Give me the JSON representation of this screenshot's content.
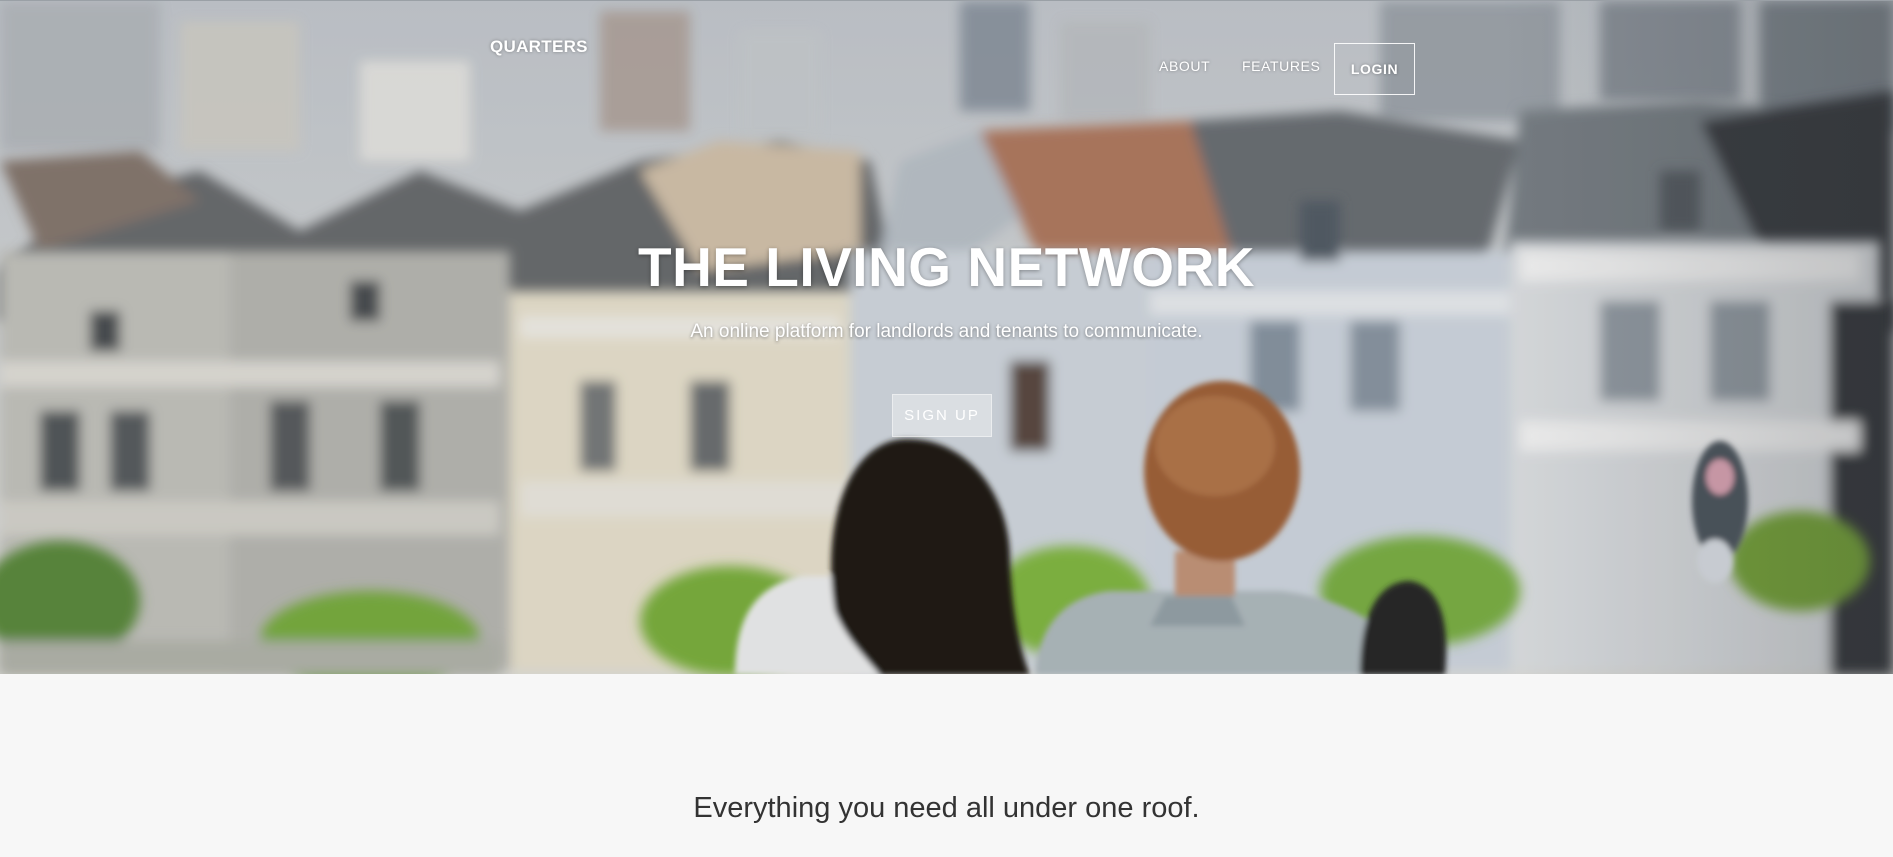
{
  "nav": {
    "brand": "QUARTERS",
    "links": [
      "ABOUT",
      "FEATURES"
    ],
    "login": "LOGIN"
  },
  "hero": {
    "title": "THE LIVING NETWORK",
    "subtitle": "An online platform for landlords and tenants to communicate.",
    "cta": "SIGN UP",
    "image": "blurred-victorian-houses-with-couple-photo"
  },
  "section": {
    "heading": "Everything you need all under one roof."
  },
  "colors": {
    "hero_text": "#ffffff",
    "page_bg": "#f7f7f7",
    "heading_text": "#333333"
  }
}
